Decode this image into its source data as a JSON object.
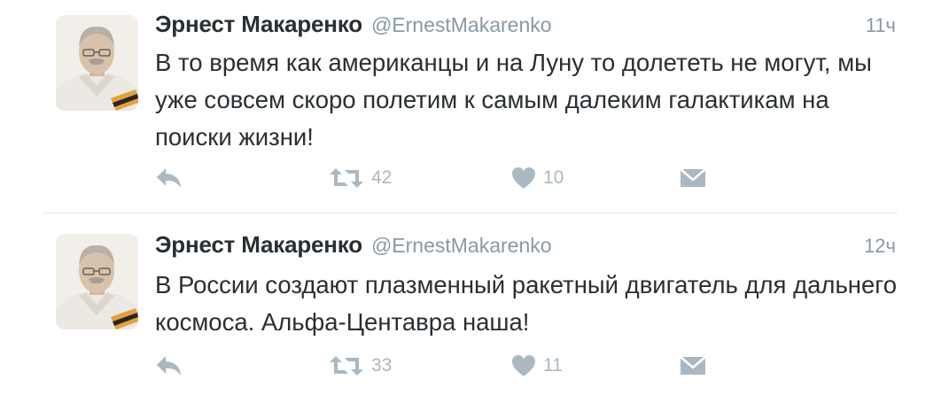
{
  "colors": {
    "name": "#292f33",
    "meta": "#8899a6",
    "icon": "#aab8c2",
    "divider": "#e1e8ed"
  },
  "tweets": [
    {
      "name": "Эрнест Макаренко",
      "handle": "@ErnestMakarenko",
      "time": "11ч",
      "text": "В то время как американцы и на Луну то долететь не могут, мы уже совсем скоро полетим к самым далеким галактикам на поиски жизни!",
      "retweets": "42",
      "likes": "10"
    },
    {
      "name": "Эрнест Макаренко",
      "handle": "@ErnestMakarenko",
      "time": "12ч",
      "text": "В России создают плазменный ракетный двигатель для дальнего космоса. Альфа-Центавра наша!",
      "retweets": "33",
      "likes": "11"
    }
  ],
  "icons": {
    "reply": "reply-icon",
    "retweet": "retweet-icon",
    "like": "heart-icon",
    "dm": "envelope-icon"
  }
}
